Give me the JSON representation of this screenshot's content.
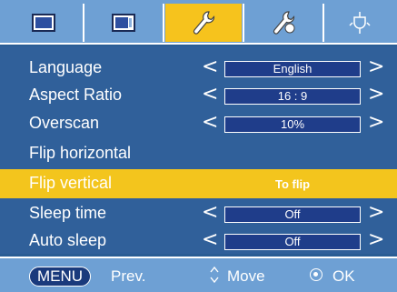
{
  "tabs": [
    {
      "name": "picture-tab",
      "icon": "monitor-icon",
      "active": false
    },
    {
      "name": "picture-adjust-tab",
      "icon": "screen-icon",
      "active": false
    },
    {
      "name": "setup-tab",
      "icon": "wrench-icon",
      "active": true
    },
    {
      "name": "option-tab",
      "icon": "wrench-plus-icon",
      "active": false
    },
    {
      "name": "input-tab",
      "icon": "plug-icon",
      "active": false
    }
  ],
  "menu": {
    "items": [
      {
        "label": "Language",
        "value": "English",
        "has_arrows": true
      },
      {
        "label": "Aspect Ratio",
        "value": "16 : 9",
        "has_arrows": true
      },
      {
        "label": "Overscan",
        "value": "10%",
        "has_arrows": true
      },
      {
        "label": "Flip horizontal",
        "value": "",
        "has_arrows": false
      },
      {
        "label": "Flip vertical",
        "value": "To flip",
        "has_arrows": false,
        "selected": true
      },
      {
        "label": "Sleep time",
        "value": "Off",
        "has_arrows": true
      },
      {
        "label": "Auto sleep",
        "value": "Off",
        "has_arrows": true
      }
    ],
    "arrow_left": "<",
    "arrow_right": ">"
  },
  "footer": {
    "menu_key": "MENU",
    "menu_action": "Prev.",
    "move_action": "Move",
    "ok_action": "OK"
  },
  "colors": {
    "background": "#30609a",
    "tabbar": "#6ea0d4",
    "highlight": "#f3c51d",
    "value_box": "#1f3d8a"
  }
}
